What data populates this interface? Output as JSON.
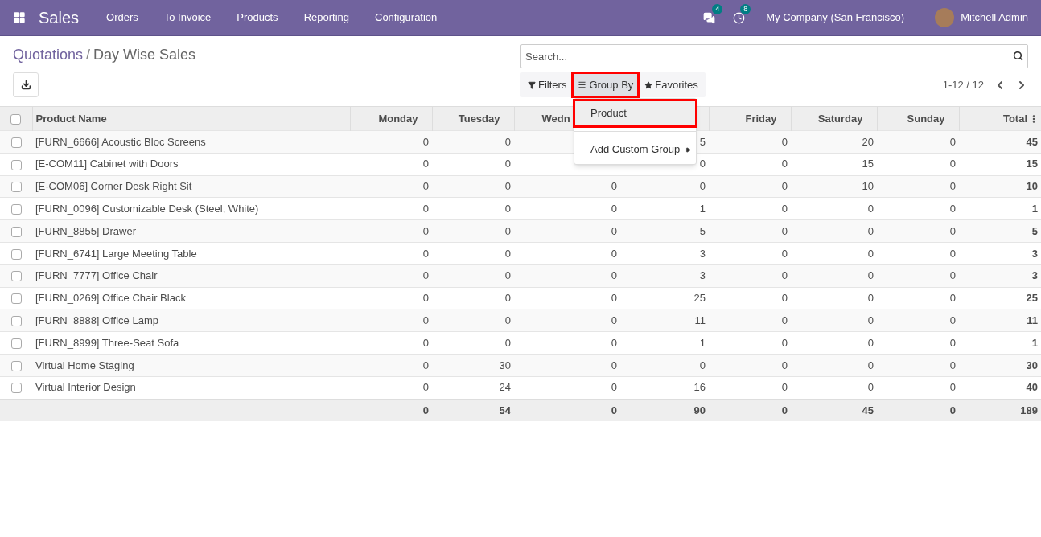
{
  "navbar": {
    "app": "Sales",
    "menu": [
      "Orders",
      "To Invoice",
      "Products",
      "Reporting",
      "Configuration"
    ],
    "messages_count": "4",
    "activities_count": "8",
    "company": "My Company (San Francisco)",
    "user": "Mitchell Admin"
  },
  "breadcrumb": [
    {
      "label": "Quotations",
      "kind": "link"
    },
    {
      "label": "/",
      "kind": "separator"
    },
    {
      "label": "Day Wise Sales",
      "kind": "current"
    }
  ],
  "search": {
    "placeholder": "Search..."
  },
  "filter_buttons": [
    {
      "label": "Filters",
      "kind": "filter",
      "selected": false,
      "annotated": false
    },
    {
      "label": "Group By",
      "kind": "group",
      "selected": true,
      "annotated": true
    },
    {
      "label": "Favorites",
      "kind": "star",
      "selected": false,
      "annotated": false
    }
  ],
  "pager": "1-12 / 12",
  "groupby_menu": {
    "items": [
      {
        "label": "Product",
        "kind": "option",
        "annotated": true
      },
      {
        "label": "Add Custom Group",
        "kind": "submenu",
        "annotated": false
      }
    ]
  },
  "table": {
    "select_all": {
      "checked": false
    },
    "columns": [
      {
        "label": "Product Name"
      },
      {
        "label": "Monday"
      },
      {
        "label": "Tuesday"
      },
      {
        "label": "Wedn"
      },
      {},
      {
        "label": "Friday"
      },
      {
        "label": "Saturday"
      },
      {
        "label": "Sunday"
      },
      {
        "label": "Total"
      }
    ],
    "rows": [
      {
        "checked": false,
        "cells": [
          "[FURN_6666] Acoustic Bloc Screens",
          "0",
          "0",
          null,
          "5",
          "0",
          "20",
          "0",
          "45"
        ]
      },
      {
        "checked": false,
        "cells": [
          "[E-COM11] Cabinet with Doors",
          "0",
          "0",
          null,
          "0",
          "0",
          "15",
          "0",
          "15"
        ]
      },
      {
        "checked": false,
        "cells": [
          "[E-COM06] Corner Desk Right Sit",
          "0",
          "0",
          "0",
          "0",
          "0",
          "10",
          "0",
          "10"
        ]
      },
      {
        "checked": false,
        "cells": [
          "[FURN_0096] Customizable Desk (Steel, White)",
          "0",
          "0",
          "0",
          "1",
          "0",
          "0",
          "0",
          "1"
        ]
      },
      {
        "checked": false,
        "cells": [
          "[FURN_8855] Drawer",
          "0",
          "0",
          "0",
          "5",
          "0",
          "0",
          "0",
          "5"
        ]
      },
      {
        "checked": false,
        "cells": [
          "[FURN_6741] Large Meeting Table",
          "0",
          "0",
          "0",
          "3",
          "0",
          "0",
          "0",
          "3"
        ]
      },
      {
        "checked": false,
        "cells": [
          "[FURN_7777] Office Chair",
          "0",
          "0",
          "0",
          "3",
          "0",
          "0",
          "0",
          "3"
        ]
      },
      {
        "checked": false,
        "cells": [
          "[FURN_0269] Office Chair Black",
          "0",
          "0",
          "0",
          "25",
          "0",
          "0",
          "0",
          "25"
        ]
      },
      {
        "checked": false,
        "cells": [
          "[FURN_8888] Office Lamp",
          "0",
          "0",
          "0",
          "11",
          "0",
          "0",
          "0",
          "11"
        ]
      },
      {
        "checked": false,
        "cells": [
          "[FURN_8999] Three-Seat Sofa",
          "0",
          "0",
          "0",
          "1",
          "0",
          "0",
          "0",
          "1"
        ]
      },
      {
        "checked": false,
        "cells": [
          "Virtual Home Staging",
          "0",
          "30",
          "0",
          "0",
          "0",
          "0",
          "0",
          "30"
        ]
      },
      {
        "checked": false,
        "cells": [
          "Virtual Interior Design",
          "0",
          "24",
          "0",
          "16",
          "0",
          "0",
          "0",
          "40"
        ]
      }
    ],
    "footer": {
      "cells": [
        null,
        "0",
        "54",
        "0",
        "90",
        "0",
        "45",
        "0",
        "189"
      ]
    }
  }
}
